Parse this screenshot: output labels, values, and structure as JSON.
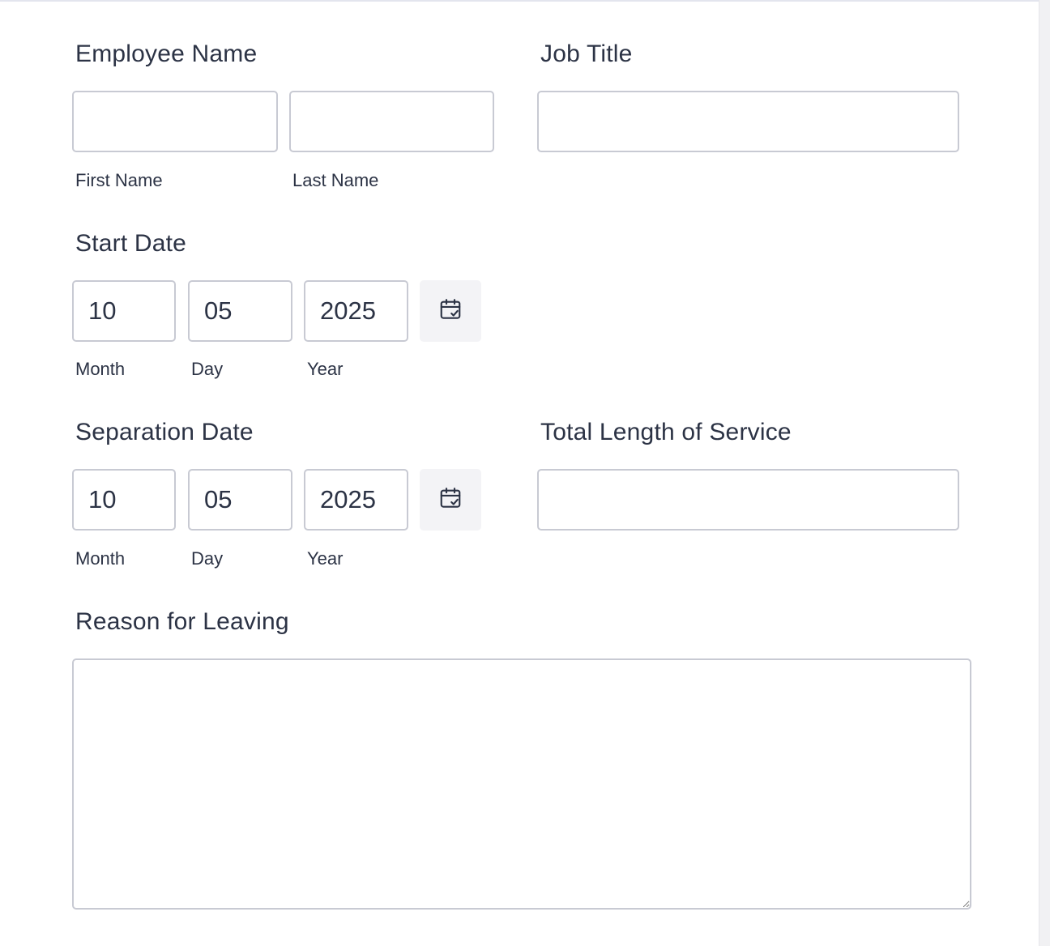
{
  "employee_name": {
    "label": "Employee Name",
    "first": {
      "value": "",
      "sublabel": "First Name"
    },
    "last": {
      "value": "",
      "sublabel": "Last Name"
    }
  },
  "job_title": {
    "label": "Job Title",
    "value": ""
  },
  "start_date": {
    "label": "Start Date",
    "month": {
      "value": "10",
      "sublabel": "Month"
    },
    "day": {
      "value": "05",
      "sublabel": "Day"
    },
    "year": {
      "value": "2025",
      "sublabel": "Year"
    },
    "icon": "calendar-check-icon"
  },
  "separation_date": {
    "label": "Separation Date",
    "month": {
      "value": "10",
      "sublabel": "Month"
    },
    "day": {
      "value": "05",
      "sublabel": "Day"
    },
    "year": {
      "value": "2025",
      "sublabel": "Year"
    },
    "icon": "calendar-check-icon"
  },
  "total_service": {
    "label": "Total Length of Service",
    "value": ""
  },
  "reason": {
    "label": "Reason for Leaving",
    "value": ""
  },
  "colors": {
    "text": "#2c3345",
    "border": "#c8cad3",
    "button_bg": "#f3f3f6"
  }
}
